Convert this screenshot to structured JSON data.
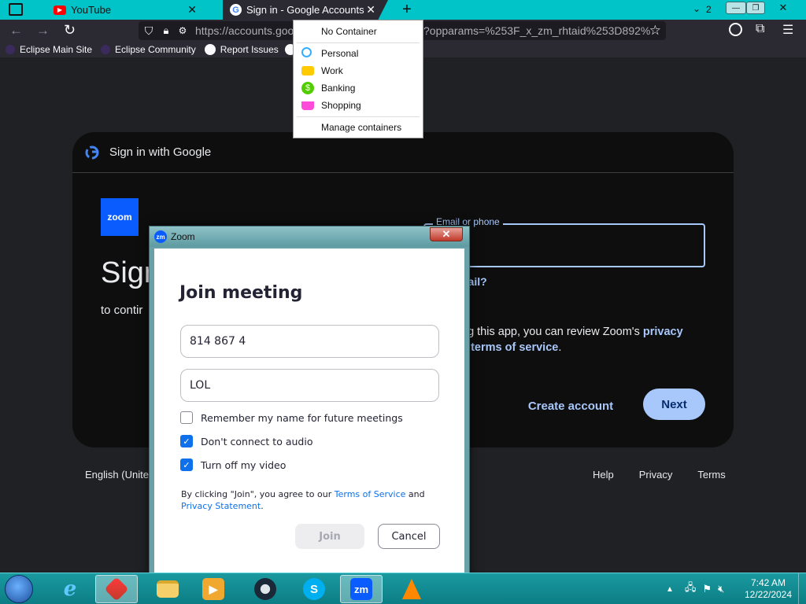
{
  "browser": {
    "tabs": [
      {
        "title": "YouTube",
        "icon": "youtube-icon"
      },
      {
        "title": "Sign in - Google Accounts",
        "icon": "google-icon",
        "active": true
      }
    ],
    "tab_count": "2",
    "url": "https://accounts.goo",
    "url_tail": "?opparams=%253F_x_zm_rhtaid%253D892%",
    "bookmarks": [
      "Eclipse Main Site",
      "Eclipse Community",
      "Report Issues"
    ],
    "accent_color": "#00c4c8"
  },
  "container_menu": {
    "no_container": "No Container",
    "items": [
      {
        "label": "Personal",
        "icon": "fingerprint-icon",
        "color": "#37adff"
      },
      {
        "label": "Work",
        "icon": "briefcase-icon",
        "color": "#ffcb00"
      },
      {
        "label": "Banking",
        "icon": "dollar-icon",
        "color": "#51cd00"
      },
      {
        "label": "Shopping",
        "icon": "cart-icon",
        "color": "#ff4bda"
      }
    ],
    "manage": "Manage containers"
  },
  "google": {
    "header": "Sign in with Google",
    "app_logo": "zoom",
    "title": "Sign",
    "subtitle": "to contir",
    "email_label": "Email or phone",
    "forgot": "nail?",
    "privacy_line1": "ng this app, you can review Zoom's ",
    "privacy_link": "privacy",
    "privacy_line2_pre": "d ",
    "terms_link": "terms of service",
    "privacy_line2_post": ".",
    "create_account": "Create account",
    "next": "Next",
    "language": "English (United",
    "footer": [
      "Help",
      "Privacy",
      "Terms"
    ]
  },
  "zoom_dialog": {
    "window_title": "Zoom",
    "heading": "Join meeting",
    "meeting_id": "814 867 4",
    "name": "LOL",
    "checks": [
      {
        "label": "Remember my name for future meetings",
        "checked": false
      },
      {
        "label": "Don't connect to audio",
        "checked": true
      },
      {
        "label": "Turn off my video",
        "checked": true
      }
    ],
    "legal_pre": "By clicking \"Join\", you agree to our ",
    "legal_tos": "Terms of Service",
    "legal_and": " and",
    "legal_privacy": "Privacy Statement",
    "legal_end": ".",
    "join": "Join",
    "cancel": "Cancel"
  },
  "taskbar": {
    "apps": [
      {
        "name": "internet-explorer",
        "glyph": "e"
      },
      {
        "name": "firefox",
        "glyph": ""
      },
      {
        "name": "file-explorer",
        "glyph": ""
      },
      {
        "name": "media-player",
        "glyph": ""
      },
      {
        "name": "steam",
        "glyph": ""
      },
      {
        "name": "skype",
        "glyph": "S"
      },
      {
        "name": "zoom",
        "glyph": "zm"
      },
      {
        "name": "vlc",
        "glyph": ""
      }
    ],
    "time": "7:42 AM",
    "date": "12/22/2024"
  }
}
